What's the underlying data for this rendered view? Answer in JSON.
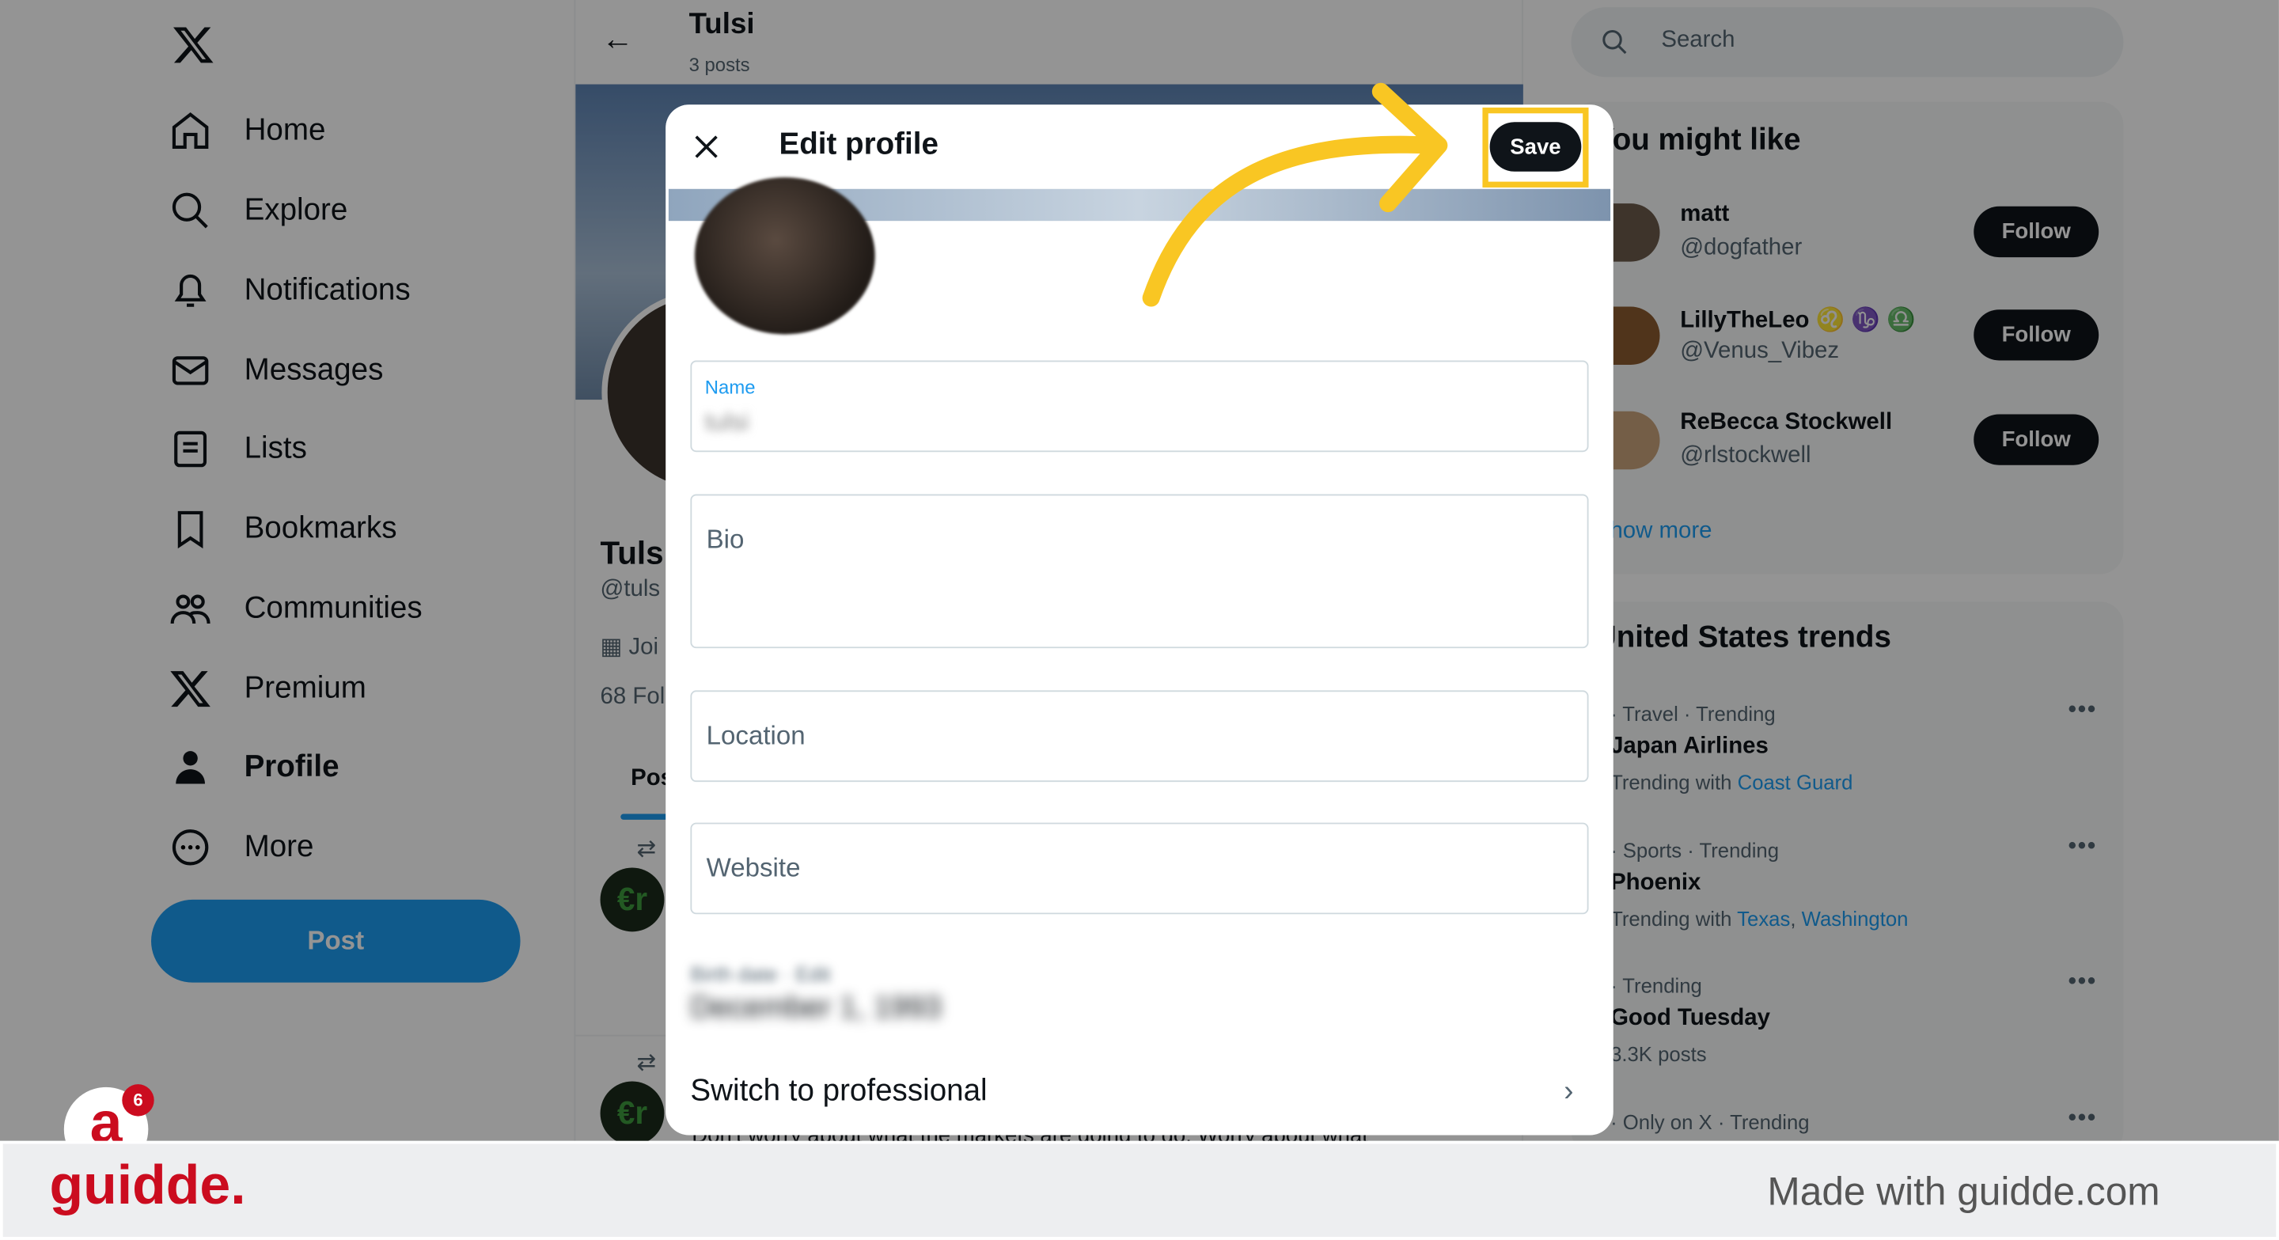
{
  "sidebar": {
    "items": [
      {
        "label": "Home",
        "icon": "home-icon"
      },
      {
        "label": "Explore",
        "icon": "search-icon"
      },
      {
        "label": "Notifications",
        "icon": "bell-icon"
      },
      {
        "label": "Messages",
        "icon": "mail-icon"
      },
      {
        "label": "Lists",
        "icon": "list-icon"
      },
      {
        "label": "Bookmarks",
        "icon": "bookmark-icon"
      },
      {
        "label": "Communities",
        "icon": "people-icon"
      },
      {
        "label": "Premium",
        "icon": "x-icon"
      },
      {
        "label": "Profile",
        "icon": "person-icon"
      },
      {
        "label": "More",
        "icon": "more-icon"
      }
    ],
    "post_label": "Post",
    "badge_count": "6"
  },
  "profile": {
    "name": "Tulsi",
    "posts": "3 posts",
    "name_partial": "Tuls",
    "handle_partial": "@tuls",
    "joined_partial": "Joi",
    "followers_partial": "68 Fol",
    "tab_partial": "Pos",
    "tweet_text": "Don't worry about what the markets are going to do. Worry about what"
  },
  "search": {
    "placeholder": "Search"
  },
  "suggestions": {
    "title": "You might like",
    "show_more": "Show more",
    "follow_label": "Follow",
    "items": [
      {
        "name": "matt",
        "handle": "@dogfather"
      },
      {
        "name": "LillyTheLeo ♌ ♑ ♎",
        "handle": "@Venus_Vibez"
      },
      {
        "name": "ReBecca Stockwell",
        "handle": "@rlstockwell"
      }
    ]
  },
  "trends": {
    "title": "United States trends",
    "items": [
      {
        "meta": "· Travel · Trending",
        "title": "Japan Airlines",
        "sub": "Trending with",
        "links": [
          "Coast Guard"
        ]
      },
      {
        "meta": "· Sports · Trending",
        "title": "Phoenix",
        "sub": "Trending with",
        "links": [
          "Texas",
          "Washington"
        ]
      },
      {
        "meta": "· Trending",
        "title": "Good Tuesday",
        "sub": "3.3K posts",
        "links": []
      },
      {
        "meta": "· Only on X · Trending",
        "title": "",
        "sub": "",
        "links": []
      }
    ]
  },
  "modal": {
    "title": "Edit profile",
    "save_label": "Save",
    "name_label": "Name",
    "name_value": "tulsi",
    "bio_placeholder": "Bio",
    "location_placeholder": "Location",
    "website_placeholder": "Website",
    "birth_label": "Birth date · Edit",
    "birth_value": "December 1, 1993",
    "switch_label": "Switch to professional"
  },
  "footer": {
    "brand": "guidde.",
    "made_with": "Made with guidde.com"
  },
  "colors": {
    "accent": "#1d9bf0",
    "highlight": "#f9c623",
    "brand": "#cb0c1f"
  }
}
